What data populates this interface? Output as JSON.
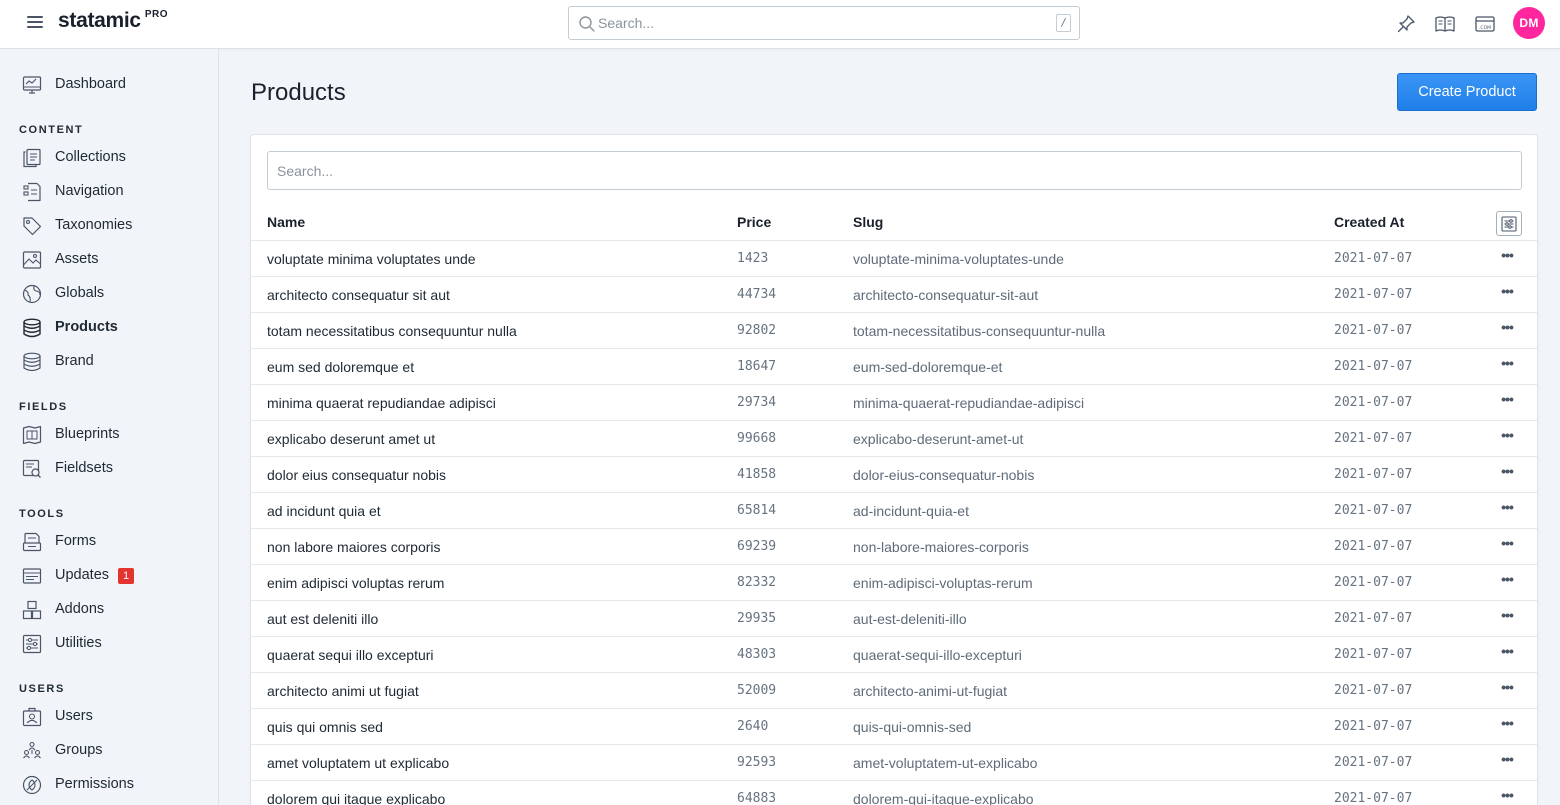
{
  "app": {
    "brand": "statamic",
    "brand_tier": "PRO",
    "search_placeholder": "Search...",
    "search_shortcut": "/",
    "user_initials": "DM",
    "avatar_color": "#ff269e"
  },
  "sidebar": {
    "top_items": [
      {
        "label": "Dashboard",
        "icon": "dashboard-icon"
      }
    ],
    "sections": [
      {
        "heading": "CONTENT",
        "items": [
          {
            "label": "Collections",
            "icon": "collections-icon"
          },
          {
            "label": "Navigation",
            "icon": "navigation-icon"
          },
          {
            "label": "Taxonomies",
            "icon": "tag-icon"
          },
          {
            "label": "Assets",
            "icon": "image-icon"
          },
          {
            "label": "Globals",
            "icon": "globe-icon"
          },
          {
            "label": "Products",
            "icon": "database-icon",
            "active": true
          },
          {
            "label": "Brand",
            "icon": "database-icon"
          }
        ]
      },
      {
        "heading": "FIELDS",
        "items": [
          {
            "label": "Blueprints",
            "icon": "blueprint-icon"
          },
          {
            "label": "Fieldsets",
            "icon": "fieldset-icon"
          }
        ]
      },
      {
        "heading": "TOOLS",
        "items": [
          {
            "label": "Forms",
            "icon": "form-icon"
          },
          {
            "label": "Updates",
            "icon": "updates-icon",
            "badge": "1"
          },
          {
            "label": "Addons",
            "icon": "addons-icon"
          },
          {
            "label": "Utilities",
            "icon": "utilities-icon"
          }
        ]
      },
      {
        "heading": "USERS",
        "items": [
          {
            "label": "Users",
            "icon": "users-icon"
          },
          {
            "label": "Groups",
            "icon": "groups-icon"
          },
          {
            "label": "Permissions",
            "icon": "permissions-icon"
          }
        ]
      }
    ]
  },
  "main": {
    "title": "Products",
    "create_label": "Create Product",
    "list_search_placeholder": "Search...",
    "columns": [
      "Name",
      "Price",
      "Slug",
      "Created At"
    ],
    "rows": [
      {
        "name": "voluptate minima voluptates unde",
        "price": "1423",
        "slug": "voluptate-minima-voluptates-unde",
        "created": "2021-07-07"
      },
      {
        "name": "architecto consequatur sit aut",
        "price": "44734",
        "slug": "architecto-consequatur-sit-aut",
        "created": "2021-07-07"
      },
      {
        "name": "totam necessitatibus consequuntur nulla",
        "price": "92802",
        "slug": "totam-necessitatibus-consequuntur-nulla",
        "created": "2021-07-07"
      },
      {
        "name": "eum sed doloremque et",
        "price": "18647",
        "slug": "eum-sed-doloremque-et",
        "created": "2021-07-07"
      },
      {
        "name": "minima quaerat repudiandae adipisci",
        "price": "29734",
        "slug": "minima-quaerat-repudiandae-adipisci",
        "created": "2021-07-07"
      },
      {
        "name": "explicabo deserunt amet ut",
        "price": "99668",
        "slug": "explicabo-deserunt-amet-ut",
        "created": "2021-07-07"
      },
      {
        "name": "dolor eius consequatur nobis",
        "price": "41858",
        "slug": "dolor-eius-consequatur-nobis",
        "created": "2021-07-07"
      },
      {
        "name": "ad incidunt quia et",
        "price": "65814",
        "slug": "ad-incidunt-quia-et",
        "created": "2021-07-07"
      },
      {
        "name": "non labore maiores corporis",
        "price": "69239",
        "slug": "non-labore-maiores-corporis",
        "created": "2021-07-07"
      },
      {
        "name": "enim adipisci voluptas rerum",
        "price": "82332",
        "slug": "enim-adipisci-voluptas-rerum",
        "created": "2021-07-07"
      },
      {
        "name": "aut est deleniti illo",
        "price": "29935",
        "slug": "aut-est-deleniti-illo",
        "created": "2021-07-07"
      },
      {
        "name": "quaerat sequi illo excepturi",
        "price": "48303",
        "slug": "quaerat-sequi-illo-excepturi",
        "created": "2021-07-07"
      },
      {
        "name": "architecto animi ut fugiat",
        "price": "52009",
        "slug": "architecto-animi-ut-fugiat",
        "created": "2021-07-07"
      },
      {
        "name": "quis qui omnis sed",
        "price": "2640",
        "slug": "quis-qui-omnis-sed",
        "created": "2021-07-07"
      },
      {
        "name": "amet voluptatem ut explicabo",
        "price": "92593",
        "slug": "amet-voluptatem-ut-explicabo",
        "created": "2021-07-07"
      },
      {
        "name": "dolorem qui itaque explicabo",
        "price": "64883",
        "slug": "dolorem-qui-itaque-explicabo",
        "created": "2021-07-07"
      }
    ]
  },
  "colors": {
    "accent": "#2c8cf4",
    "badge": "#e3342f",
    "background": "#f1f5f9"
  }
}
